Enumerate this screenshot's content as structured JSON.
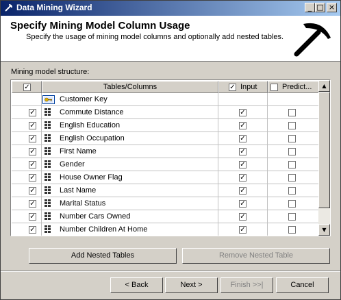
{
  "window": {
    "title": "Data Mining Wizard"
  },
  "titlebar_buttons": {
    "minimize": "_",
    "maximize": "□",
    "close": "×"
  },
  "header": {
    "title": "Specify Mining Model Column Usage",
    "subtitle": "Specify the usage of mining model columns and optionally add nested tables."
  },
  "structure_label": "Mining model structure:",
  "grid": {
    "columns": {
      "tables_columns": "Tables/Columns",
      "input": "Input",
      "predict": "Predict..."
    },
    "header_checks": {
      "select_all": true,
      "input": true,
      "predict": false
    },
    "rows": [
      {
        "name": "Customer Key",
        "selected": null,
        "input": null,
        "predict": null,
        "icon": "key-icon"
      },
      {
        "name": "Commute Distance",
        "selected": true,
        "input": true,
        "predict": false,
        "icon": "column-icon"
      },
      {
        "name": "English Education",
        "selected": true,
        "input": true,
        "predict": false,
        "icon": "column-icon"
      },
      {
        "name": "English Occupation",
        "selected": true,
        "input": true,
        "predict": false,
        "icon": "column-icon"
      },
      {
        "name": "First Name",
        "selected": true,
        "input": true,
        "predict": false,
        "icon": "column-icon"
      },
      {
        "name": "Gender",
        "selected": true,
        "input": true,
        "predict": false,
        "icon": "column-icon"
      },
      {
        "name": "House Owner Flag",
        "selected": true,
        "input": true,
        "predict": false,
        "icon": "column-icon"
      },
      {
        "name": "Last Name",
        "selected": true,
        "input": true,
        "predict": false,
        "icon": "column-icon"
      },
      {
        "name": "Marital Status",
        "selected": true,
        "input": true,
        "predict": false,
        "icon": "column-icon"
      },
      {
        "name": "Number Cars Owned",
        "selected": true,
        "input": true,
        "predict": false,
        "icon": "column-icon"
      },
      {
        "name": "Number Children At Home",
        "selected": true,
        "input": true,
        "predict": false,
        "icon": "column-icon"
      }
    ]
  },
  "buttons": {
    "add_nested": "Add Nested Tables",
    "remove_nested": "Remove Nested Table",
    "back": "< Back",
    "next": "Next >",
    "finish": "Finish >>|",
    "cancel": "Cancel"
  }
}
